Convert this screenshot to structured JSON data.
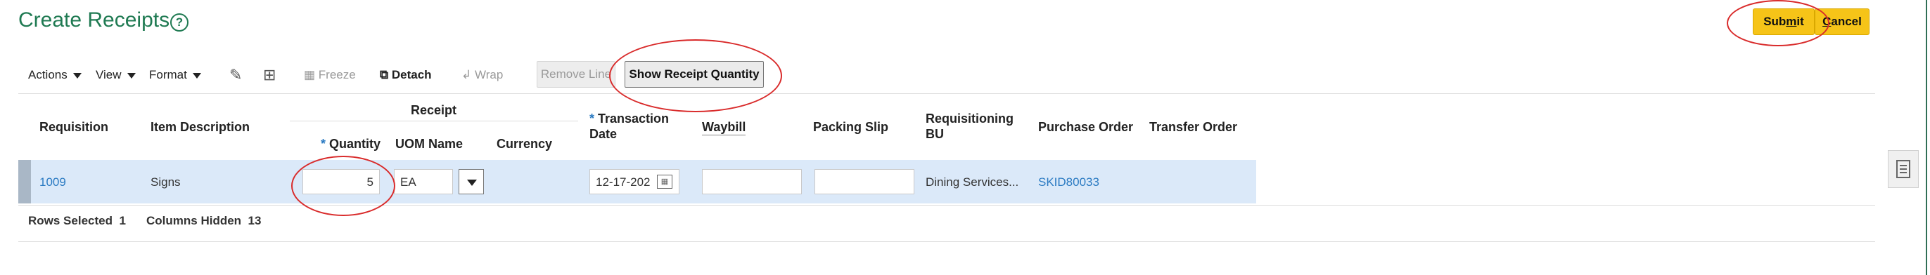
{
  "page": {
    "title": "Create Receipts"
  },
  "header": {
    "submit_prefix": "Sub",
    "submit_underline": "m",
    "submit_suffix": "it",
    "cancel_underline": "C",
    "cancel_suffix": "ancel"
  },
  "toolbar": {
    "actions": "Actions",
    "view": "View",
    "format": "Format",
    "freeze": "Freeze",
    "detach": "Detach",
    "wrap": "Wrap",
    "remove_line": "Remove Line",
    "show_receipt_quantity": "Show Receipt Quantity"
  },
  "table": {
    "headers": {
      "requisition": "Requisition",
      "item_description": "Item Description",
      "receipt_group": "Receipt",
      "quantity": "Quantity",
      "uom_name": "UOM Name",
      "currency": "Currency",
      "transaction_date_1": "Transaction",
      "transaction_date_2": "Date",
      "waybill": "Waybill",
      "packing_slip": "Packing Slip",
      "requisitioning_bu_1": "Requisitioning",
      "requisitioning_bu_2": "BU",
      "purchase_order": "Purchase Order",
      "transfer_order": "Transfer Order"
    },
    "rows": [
      {
        "requisition": "1009",
        "item_description": "Signs",
        "quantity": "5",
        "uom_name": "EA",
        "currency": "",
        "transaction_date": "12-17-202",
        "waybill": "",
        "packing_slip": "",
        "requisitioning_bu": "Dining Services...",
        "purchase_order": "SKID80033",
        "transfer_order": ""
      }
    ]
  },
  "footer": {
    "rows_selected_label": "Rows Selected",
    "rows_selected_value": "1",
    "columns_hidden_label": "Columns Hidden",
    "columns_hidden_value": "13"
  },
  "colors": {
    "title": "#1f7a52",
    "accent_button": "#f6c418",
    "link": "#2a7ac2",
    "selected_row": "#dbe9f9",
    "annotation": "#d92b2b"
  }
}
